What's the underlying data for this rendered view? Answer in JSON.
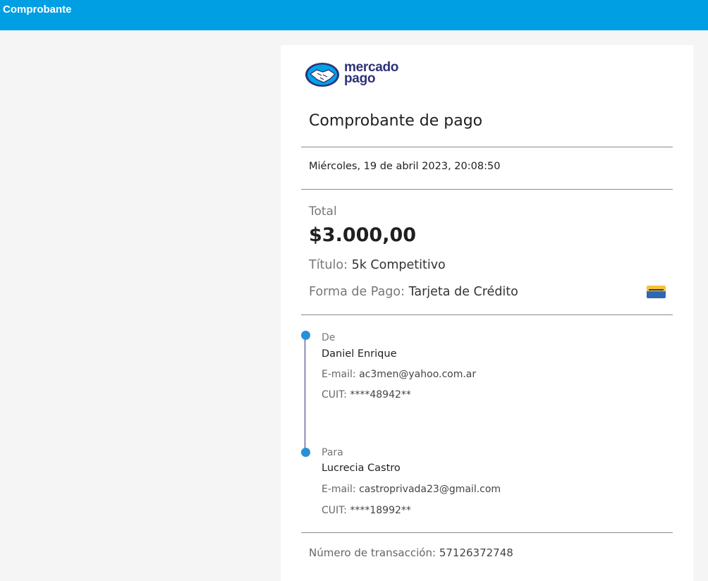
{
  "topbar": {
    "title": "Comprobante",
    "color": "#009ee3"
  },
  "logo": {
    "line1": "mercado",
    "line2": "pago",
    "icon": "handshake-icon"
  },
  "receipt": {
    "title": "Comprobante de pago",
    "date": "Miércoles, 19 de abril 2023, 20:08:50",
    "total_label": "Total",
    "total_amount": "$3.000,00",
    "title_label": "Título:",
    "title_value": "5k Competitivo",
    "payment_label": "Forma de Pago:",
    "payment_value": "Tarjeta de Crédito",
    "payment_icon": "credit-card-icon"
  },
  "from": {
    "label": "De",
    "name": "Daniel Enrique",
    "email_label": "E-mail:",
    "email": "ac3men@yahoo.com.ar",
    "cuit_label": "CUIT:",
    "cuit": "****48942**"
  },
  "to": {
    "label": "Para",
    "name": "Lucrecia Castro",
    "email_label": "E-mail:",
    "email": "castroprivada23@gmail.com",
    "cuit_label": "CUIT:",
    "cuit": "****18992**"
  },
  "transaction": {
    "label": "Número de transacción:",
    "number": "57126372748"
  }
}
